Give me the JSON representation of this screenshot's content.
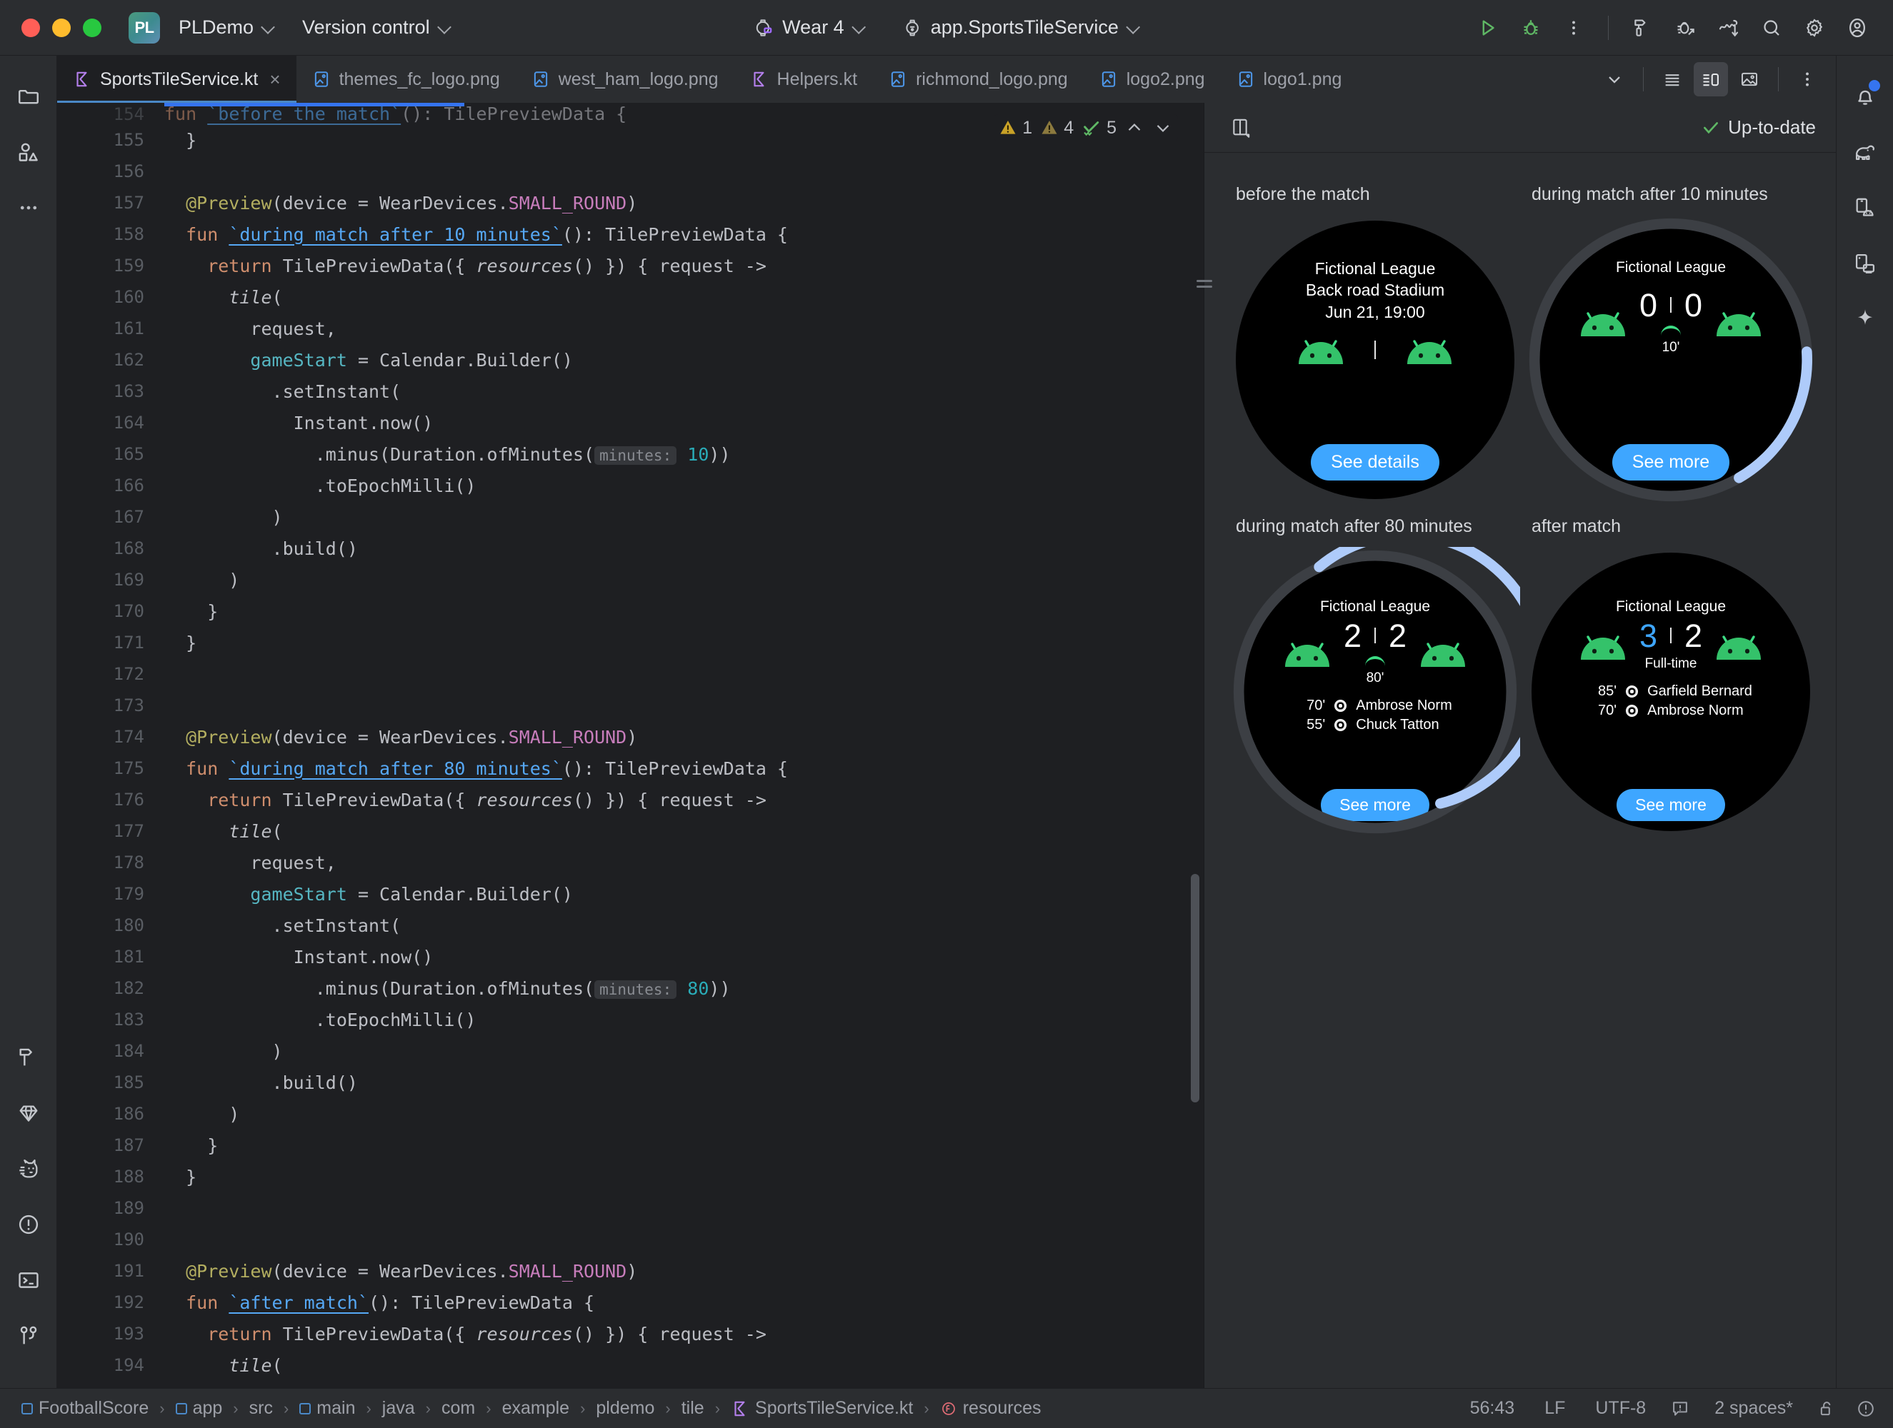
{
  "titlebar": {
    "project_badge": "PL",
    "project_name": "PLDemo",
    "version_control": "Version control",
    "device": "Wear 4",
    "run_config": "app.SportsTileService",
    "icons": {
      "run": "run-icon",
      "debug": "debug-icon",
      "more": "more-vertical-icon",
      "build": "hammer-build-icon",
      "debug_attach": "debug-attach-icon",
      "profiler": "profiler-icon",
      "search": "search-icon",
      "settings": "gear-icon",
      "account": "account-avatar-icon"
    }
  },
  "tabs": [
    {
      "label": "SportsTileService.kt",
      "icon": "kotlin-file-icon",
      "active": true,
      "closable": true
    },
    {
      "label": "themes_fc_logo.png",
      "icon": "image-file-icon",
      "active": false,
      "closable": false
    },
    {
      "label": "west_ham_logo.png",
      "icon": "image-file-icon",
      "active": false,
      "closable": false
    },
    {
      "label": "Helpers.kt",
      "icon": "kotlin-file-icon",
      "active": false,
      "closable": false
    },
    {
      "label": "richmond_logo.png",
      "icon": "image-file-icon",
      "active": false,
      "closable": false
    },
    {
      "label": "logo2.png",
      "icon": "image-file-icon",
      "active": false,
      "closable": false
    },
    {
      "label": "logo1.png",
      "icon": "image-file-icon",
      "active": false,
      "closable": false
    }
  ],
  "tabbar_actions": {
    "overflow": "chevron-down-icon",
    "list_view": "list-view-icon",
    "split_view": "split-view-icon",
    "image_view": "image-preview-icon",
    "more": "more-vertical-icon"
  },
  "inspections": {
    "warnings": "1",
    "weak_warnings": "4",
    "passed": "5",
    "up_arrow": "chevron-up-icon",
    "down_arrow": "chevron-down-icon"
  },
  "editor": {
    "lines": [
      {
        "n": "154",
        "partial": true,
        "tokens": [
          {
            "t": "fun ",
            "c": "kw"
          },
          {
            "t": "`before the match`",
            "c": "fnm"
          },
          {
            "t": "(): TilePreviewData {",
            "c": ""
          }
        ]
      },
      {
        "n": "155",
        "tokens": [
          {
            "t": "  }",
            "c": ""
          }
        ]
      },
      {
        "n": "156",
        "tokens": [
          {
            "t": "",
            "c": ""
          }
        ]
      },
      {
        "n": "157",
        "tokens": [
          {
            "t": "  @Preview",
            "c": "ann"
          },
          {
            "t": "(device = WearDevices.",
            "c": ""
          },
          {
            "t": "SMALL_ROUND",
            "c": "cst"
          },
          {
            "t": ")",
            "c": ""
          }
        ]
      },
      {
        "n": "158",
        "tokens": [
          {
            "t": "  fun ",
            "c": "kw"
          },
          {
            "t": "`during match after 10 minutes`",
            "c": "fnm"
          },
          {
            "t": "(): TilePreviewData {",
            "c": ""
          }
        ]
      },
      {
        "n": "159",
        "tokens": [
          {
            "t": "    return ",
            "c": "kw"
          },
          {
            "t": "TilePreviewData({ ",
            "c": ""
          },
          {
            "t": "resources",
            "c": "ital"
          },
          {
            "t": "() }) { request ->",
            "c": ""
          }
        ]
      },
      {
        "n": "160",
        "tokens": [
          {
            "t": "      ",
            "c": ""
          },
          {
            "t": "tile",
            "c": "ital"
          },
          {
            "t": "(",
            "c": ""
          }
        ]
      },
      {
        "n": "161",
        "tokens": [
          {
            "t": "        request,",
            "c": ""
          }
        ]
      },
      {
        "n": "162",
        "tokens": [
          {
            "t": "        ",
            "c": ""
          },
          {
            "t": "gameStart",
            "c": "prop"
          },
          {
            "t": " = Calendar.Builder()",
            "c": ""
          }
        ]
      },
      {
        "n": "163",
        "tokens": [
          {
            "t": "          .setInstant(",
            "c": ""
          }
        ]
      },
      {
        "n": "164",
        "tokens": [
          {
            "t": "            Instant.now()",
            "c": ""
          }
        ]
      },
      {
        "n": "165",
        "tokens": [
          {
            "t": "              .minus(Duration.ofMinutes(",
            "c": ""
          },
          {
            "t": "minutes:",
            "c": "hint"
          },
          {
            "t": " ",
            "c": ""
          },
          {
            "t": "10",
            "c": "num"
          },
          {
            "t": "))",
            "c": ""
          }
        ]
      },
      {
        "n": "166",
        "tokens": [
          {
            "t": "              .toEpochMilli()",
            "c": ""
          }
        ]
      },
      {
        "n": "167",
        "tokens": [
          {
            "t": "          )",
            "c": ""
          }
        ]
      },
      {
        "n": "168",
        "tokens": [
          {
            "t": "          .build()",
            "c": ""
          }
        ]
      },
      {
        "n": "169",
        "tokens": [
          {
            "t": "      )",
            "c": ""
          }
        ]
      },
      {
        "n": "170",
        "tokens": [
          {
            "t": "    }",
            "c": ""
          }
        ]
      },
      {
        "n": "171",
        "tokens": [
          {
            "t": "  }",
            "c": ""
          }
        ]
      },
      {
        "n": "172",
        "tokens": [
          {
            "t": "",
            "c": ""
          }
        ]
      },
      {
        "n": "173",
        "tokens": [
          {
            "t": "",
            "c": ""
          }
        ]
      },
      {
        "n": "174",
        "tokens": [
          {
            "t": "  @Preview",
            "c": "ann"
          },
          {
            "t": "(device = WearDevices.",
            "c": ""
          },
          {
            "t": "SMALL_ROUND",
            "c": "cst"
          },
          {
            "t": ")",
            "c": ""
          }
        ]
      },
      {
        "n": "175",
        "tokens": [
          {
            "t": "  fun ",
            "c": "kw"
          },
          {
            "t": "`during match after 80 minutes`",
            "c": "fnm"
          },
          {
            "t": "(): TilePreviewData {",
            "c": ""
          }
        ]
      },
      {
        "n": "176",
        "tokens": [
          {
            "t": "    return ",
            "c": "kw"
          },
          {
            "t": "TilePreviewData({ ",
            "c": ""
          },
          {
            "t": "resources",
            "c": "ital"
          },
          {
            "t": "() }) { request ->",
            "c": ""
          }
        ]
      },
      {
        "n": "177",
        "tokens": [
          {
            "t": "      ",
            "c": ""
          },
          {
            "t": "tile",
            "c": "ital"
          },
          {
            "t": "(",
            "c": ""
          }
        ]
      },
      {
        "n": "178",
        "tokens": [
          {
            "t": "        request,",
            "c": ""
          }
        ]
      },
      {
        "n": "179",
        "tokens": [
          {
            "t": "        ",
            "c": ""
          },
          {
            "t": "gameStart",
            "c": "prop"
          },
          {
            "t": " = Calendar.Builder()",
            "c": ""
          }
        ]
      },
      {
        "n": "180",
        "tokens": [
          {
            "t": "          .setInstant(",
            "c": ""
          }
        ]
      },
      {
        "n": "181",
        "tokens": [
          {
            "t": "            Instant.now()",
            "c": ""
          }
        ]
      },
      {
        "n": "182",
        "tokens": [
          {
            "t": "              .minus(Duration.ofMinutes(",
            "c": ""
          },
          {
            "t": "minutes:",
            "c": "hint"
          },
          {
            "t": " ",
            "c": ""
          },
          {
            "t": "80",
            "c": "num"
          },
          {
            "t": "))",
            "c": ""
          }
        ]
      },
      {
        "n": "183",
        "tokens": [
          {
            "t": "              .toEpochMilli()",
            "c": ""
          }
        ]
      },
      {
        "n": "184",
        "tokens": [
          {
            "t": "          )",
            "c": ""
          }
        ]
      },
      {
        "n": "185",
        "tokens": [
          {
            "t": "          .build()",
            "c": ""
          }
        ]
      },
      {
        "n": "186",
        "tokens": [
          {
            "t": "      )",
            "c": ""
          }
        ]
      },
      {
        "n": "187",
        "tokens": [
          {
            "t": "    }",
            "c": ""
          }
        ]
      },
      {
        "n": "188",
        "tokens": [
          {
            "t": "  }",
            "c": ""
          }
        ]
      },
      {
        "n": "189",
        "tokens": [
          {
            "t": "",
            "c": ""
          }
        ]
      },
      {
        "n": "190",
        "tokens": [
          {
            "t": "",
            "c": ""
          }
        ]
      },
      {
        "n": "191",
        "tokens": [
          {
            "t": "  @Preview",
            "c": "ann"
          },
          {
            "t": "(device = WearDevices.",
            "c": ""
          },
          {
            "t": "SMALL_ROUND",
            "c": "cst"
          },
          {
            "t": ")",
            "c": ""
          }
        ]
      },
      {
        "n": "192",
        "tokens": [
          {
            "t": "  fun ",
            "c": "kw"
          },
          {
            "t": "`after match`",
            "c": "fnm"
          },
          {
            "t": "(): TilePreviewData {",
            "c": ""
          }
        ]
      },
      {
        "n": "193",
        "tokens": [
          {
            "t": "    return ",
            "c": "kw"
          },
          {
            "t": "TilePreviewData({ ",
            "c": ""
          },
          {
            "t": "resources",
            "c": "ital"
          },
          {
            "t": "() }) { request ->",
            "c": ""
          }
        ]
      },
      {
        "n": "194",
        "tokens": [
          {
            "t": "      ",
            "c": ""
          },
          {
            "t": "tile",
            "c": "ital"
          },
          {
            "t": "(",
            "c": ""
          }
        ]
      }
    ]
  },
  "preview": {
    "layout_icon": "preview-layout-icon",
    "status": "Up-to-date",
    "status_icon": "check-icon",
    "items": [
      {
        "label": "before the match",
        "kind": "pre-match",
        "league": "Fictional League",
        "venue": "Back road Stadium",
        "date": "Jun 21, 19:00",
        "button": "See details",
        "ring": "none",
        "score": null,
        "minute": null,
        "scorers": []
      },
      {
        "label": "during match after 10 minutes",
        "kind": "live",
        "league": "Fictional League",
        "button": "See more",
        "ring": "small",
        "score": {
          "home": "0",
          "away": "0",
          "home_highlight": false
        },
        "minute": "10'",
        "scorers": []
      },
      {
        "label": "during match after 80 minutes",
        "kind": "live",
        "league": "Fictional League",
        "button": "See more",
        "ring": "large",
        "score": {
          "home": "2",
          "away": "2",
          "home_highlight": false
        },
        "minute": "80'",
        "scorers": [
          {
            "minute": "70'",
            "name": "Ambrose Norm"
          },
          {
            "minute": "55'",
            "name": "Chuck Tatton"
          }
        ]
      },
      {
        "label": "after match",
        "kind": "final",
        "league": "Fictional League",
        "button": "See more",
        "ring": "none",
        "score": {
          "home": "3",
          "away": "2",
          "home_highlight": true
        },
        "minute": "Full-time",
        "scorers": [
          {
            "minute": "85'",
            "name": "Garfield Bernard"
          },
          {
            "minute": "70'",
            "name": "Ambrose Norm"
          }
        ]
      }
    ]
  },
  "left_rail": [
    {
      "icon": "project-folder-icon",
      "name": "project"
    },
    {
      "icon": "shapes-resource-icon",
      "name": "resource-manager"
    },
    {
      "icon": "more-horizontal-icon",
      "name": "more-tool-windows"
    },
    {
      "icon": "hammer-build-icon",
      "name": "build"
    },
    {
      "icon": "gem-gradle-icon",
      "name": "gradle"
    },
    {
      "icon": "cat-logcat-icon",
      "name": "logcat"
    },
    {
      "icon": "problems-warning-icon",
      "name": "problems"
    },
    {
      "icon": "terminal-icon",
      "name": "terminal"
    },
    {
      "icon": "git-branch-icon",
      "name": "version-control"
    }
  ],
  "right_rail": [
    {
      "icon": "notifications-bell-icon",
      "name": "notifications",
      "badge": true
    },
    {
      "icon": "gradle-elephant-icon",
      "name": "gradle-panel"
    },
    {
      "icon": "device-manager-icon",
      "name": "device-manager"
    },
    {
      "icon": "running-devices-icon",
      "name": "running-devices"
    },
    {
      "icon": "gemini-sparkle-icon",
      "name": "gemini"
    }
  ],
  "statusbar": {
    "breadcrumbs": [
      {
        "label": "FootballScore",
        "icon": "module-icon"
      },
      {
        "label": "app",
        "icon": "module-icon"
      },
      {
        "label": "src",
        "icon": ""
      },
      {
        "label": "main",
        "icon": "module-icon"
      },
      {
        "label": "java",
        "icon": ""
      },
      {
        "label": "com",
        "icon": ""
      },
      {
        "label": "example",
        "icon": ""
      },
      {
        "label": "pldemo",
        "icon": ""
      },
      {
        "label": "tile",
        "icon": ""
      },
      {
        "label": "SportsTileService.kt",
        "icon": "kotlin-file-icon"
      },
      {
        "label": "resources",
        "icon": "function-icon"
      }
    ],
    "caret": "56:43",
    "line_sep": "LF",
    "encoding": "UTF-8",
    "indent": "2 spaces*",
    "icons": {
      "memory": "memory-indicator-icon",
      "lock": "unlocked-icon",
      "inspection": "inspection-icon"
    }
  },
  "colors": {
    "accent_blue": "#3574f0",
    "wear_button_blue": "#3ea6ff",
    "android_green": "#3ddc84",
    "ring_blue": "#aecbfa",
    "warning_yellow": "#c9a227",
    "check_green": "#5fb865"
  }
}
